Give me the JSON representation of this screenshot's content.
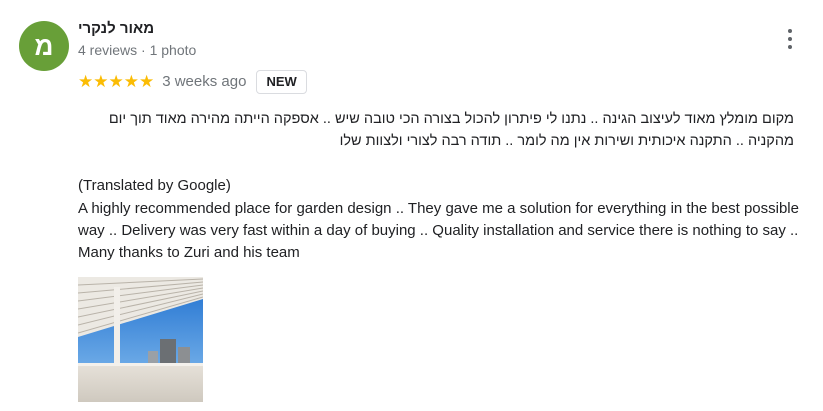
{
  "reviewer": {
    "avatar_letter": "מ",
    "avatar_color": "#689f38",
    "name": "מאור לנקרי",
    "meta": "4 reviews · 1 photo"
  },
  "review": {
    "stars": "★★★★★",
    "rating": 5,
    "time_ago": "3 weeks ago",
    "badge": "NEW",
    "original_text": "מקום מומלץ מאוד לעיצוב הגינה .. נתנו לי פיתרון להכול בצורה הכי טובה שיש .. אספקה הייתה מהירה מאוד תוך יום מהקניה .. התקנה איכותית ושירות אין מה לומר .. תודה רבה לצורי ולצוות שלו",
    "translated_label": "(Translated by Google)",
    "translated_text": "A highly recommended place for garden design .. They gave me a solution for everything in the best possible way .. Delivery was very fast within a day of buying .. Quality installation and service there is nothing to say .. Many thanks to Zuri and his team"
  },
  "icons": {
    "more": "more-vert-icon",
    "star": "star-icon"
  },
  "colors": {
    "star": "#fbbc04",
    "secondary_text": "#70757a"
  }
}
